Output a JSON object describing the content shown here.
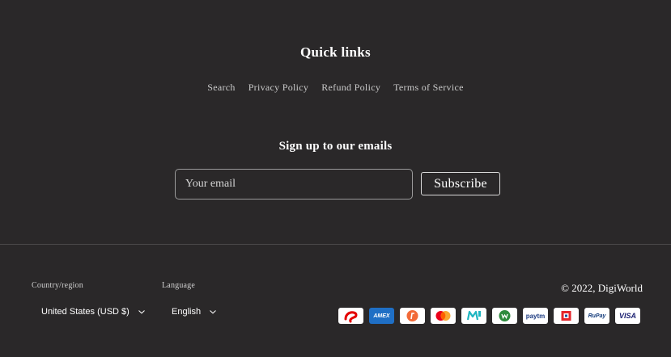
{
  "quick_links": {
    "title": "Quick links",
    "links": [
      "Search",
      "Privacy Policy",
      "Refund Policy",
      "Terms of Service"
    ]
  },
  "newsletter": {
    "title": "Sign up to our emails",
    "email_placeholder": "Your email",
    "subscribe_label": "Subscribe"
  },
  "footer": {
    "country_label": "Country/region",
    "country_value": "United States (USD $)",
    "language_label": "Language",
    "language_value": "English",
    "copyright": "© 2022, DigiWorld",
    "payment_icons": [
      "airtel-icon",
      "amex-icon",
      "freecharge-icon",
      "mastercard-icon",
      "mobikwik-icon",
      "ola-money-icon",
      "paytm-icon",
      "hdfc-icon",
      "rupay-icon",
      "visa-icon"
    ],
    "payment_texts": {
      "amex": "AMEX",
      "paytm": "paytm",
      "rupay": "RuPay",
      "visa": "VISA"
    }
  },
  "colors": {
    "background": "#2a2829",
    "text": "#ffffff",
    "muted": "#c9c9c9",
    "amex": "#1f6fc5",
    "mastercard_red": "#eb001b",
    "mastercard_orange": "#f79e1b",
    "visa": "#1a1f71"
  }
}
